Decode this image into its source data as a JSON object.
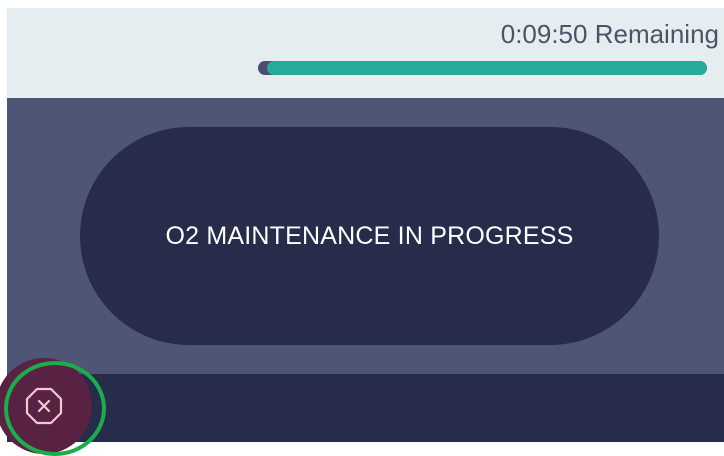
{
  "timer": {
    "remaining_label": "0:09:50 Remaining",
    "progress_fraction": 0.98
  },
  "status": {
    "message": "O2 MAINTENANCE IN PROGRESS"
  },
  "controls": {
    "close_icon": "close-octagon-icon"
  },
  "colors": {
    "topbar_bg": "#e6edf1",
    "main_bg": "#4f5574",
    "pill_bg": "#262c4a",
    "progress_fill": "#25aa9b",
    "progress_track": "#4a4e6a",
    "close_button_bg": "#5a2242",
    "highlight_ring": "#1aad4a"
  }
}
